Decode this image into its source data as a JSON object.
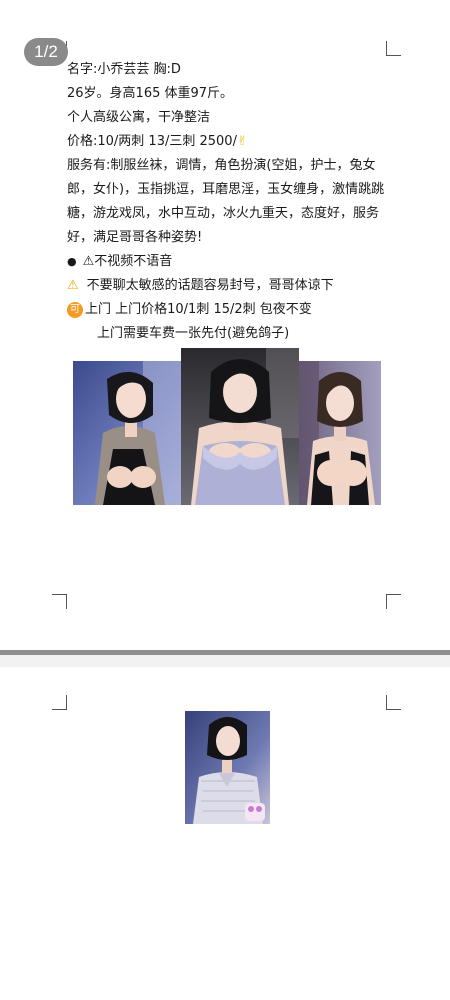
{
  "page_counter": "1/2",
  "profile": {
    "line_name": "名字:小乔芸芸  胸:D",
    "line_age": "26岁。身高165  体重97斤。",
    "line_apartment": "个人高级公寓，干净整洁",
    "line_price": "价格:10/两刺 13/三刺 2500/",
    "price_emoji": "✌",
    "services": "服务有:制服丝袜，调情，角色扮演(空姐，护士，兔女郎，女仆)，玉指挑逗，耳磨思淫，玉女缠身，激情跳跳糖，游龙戏凤，水中互动，冰火九重天，态度好，服务好，满足哥哥各种姿势!",
    "bullet_line": "⚠不视频不语音",
    "warning_icon": "⚠",
    "warning_line": "不要聊太敏感的话题容易封号，哥哥体谅下",
    "ke_badge": "可",
    "outcall_line": "上门  上门价格10/1刺  15/2刺    包夜不变",
    "fee_line": "上门需要车费一张先付(避免鸽子)"
  }
}
